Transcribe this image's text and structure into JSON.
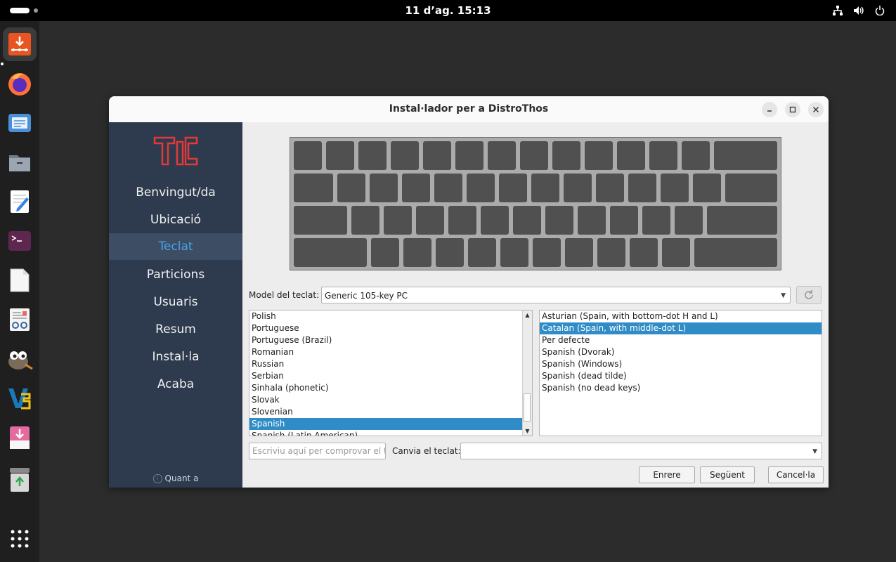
{
  "topbar": {
    "datetime": "11 d’ag.  15:13"
  },
  "dock": {
    "items": [
      {
        "icon": "installer-icon"
      },
      {
        "icon": "firefox-icon"
      },
      {
        "icon": "mail-icon"
      },
      {
        "icon": "files-icon"
      },
      {
        "icon": "text-editor-icon"
      },
      {
        "icon": "terminal-icon"
      },
      {
        "icon": "document-icon"
      },
      {
        "icon": "reader-icon"
      },
      {
        "icon": "gimp-icon"
      },
      {
        "icon": "vs-icon"
      },
      {
        "icon": "package-installer-icon"
      },
      {
        "icon": "trash-icon"
      },
      {
        "icon": "app-grid-icon"
      }
    ]
  },
  "window": {
    "title": "Instal·lador per a DistroThos"
  },
  "sidebar": {
    "items": [
      {
        "label": "Benvingut/da"
      },
      {
        "label": "Ubicació"
      },
      {
        "label": "Teclat"
      },
      {
        "label": "Particions"
      },
      {
        "label": "Usuaris"
      },
      {
        "label": "Resum"
      },
      {
        "label": "Instal·la"
      },
      {
        "label": "Acaba"
      }
    ],
    "about_label": "Quant a",
    "active_color": "#4aa2e6"
  },
  "keyboard_model": {
    "label": "Model del teclat:",
    "value": "Generic 105-key PC"
  },
  "layouts": {
    "items": [
      "Polish",
      "Portuguese",
      "Portuguese (Brazil)",
      "Romanian",
      "Russian",
      "Serbian",
      "Sinhala (phonetic)",
      "Slovak",
      "Slovenian",
      "Spanish",
      "Spanish (Latin American)"
    ],
    "selected": "Spanish"
  },
  "variants": {
    "items": [
      "Asturian (Spain, with bottom-dot H and L)",
      "Catalan (Spain, with middle-dot L)",
      "Per defecte",
      "Spanish (Dvorak)",
      "Spanish (Windows)",
      "Spanish (dead tilde)",
      "Spanish (no dead keys)"
    ],
    "selected": "Catalan (Spain, with middle-dot L)"
  },
  "test_input": {
    "placeholder": "Escriviu aquí per comprovar el t..."
  },
  "switch": {
    "label": "Canvia el teclat:",
    "value": ""
  },
  "buttons": {
    "back": "Enrere",
    "next": "Següent",
    "cancel": "Cancel·la"
  },
  "colors": {
    "selection": "#308cc6",
    "sidebar": "#2e3b4e"
  }
}
